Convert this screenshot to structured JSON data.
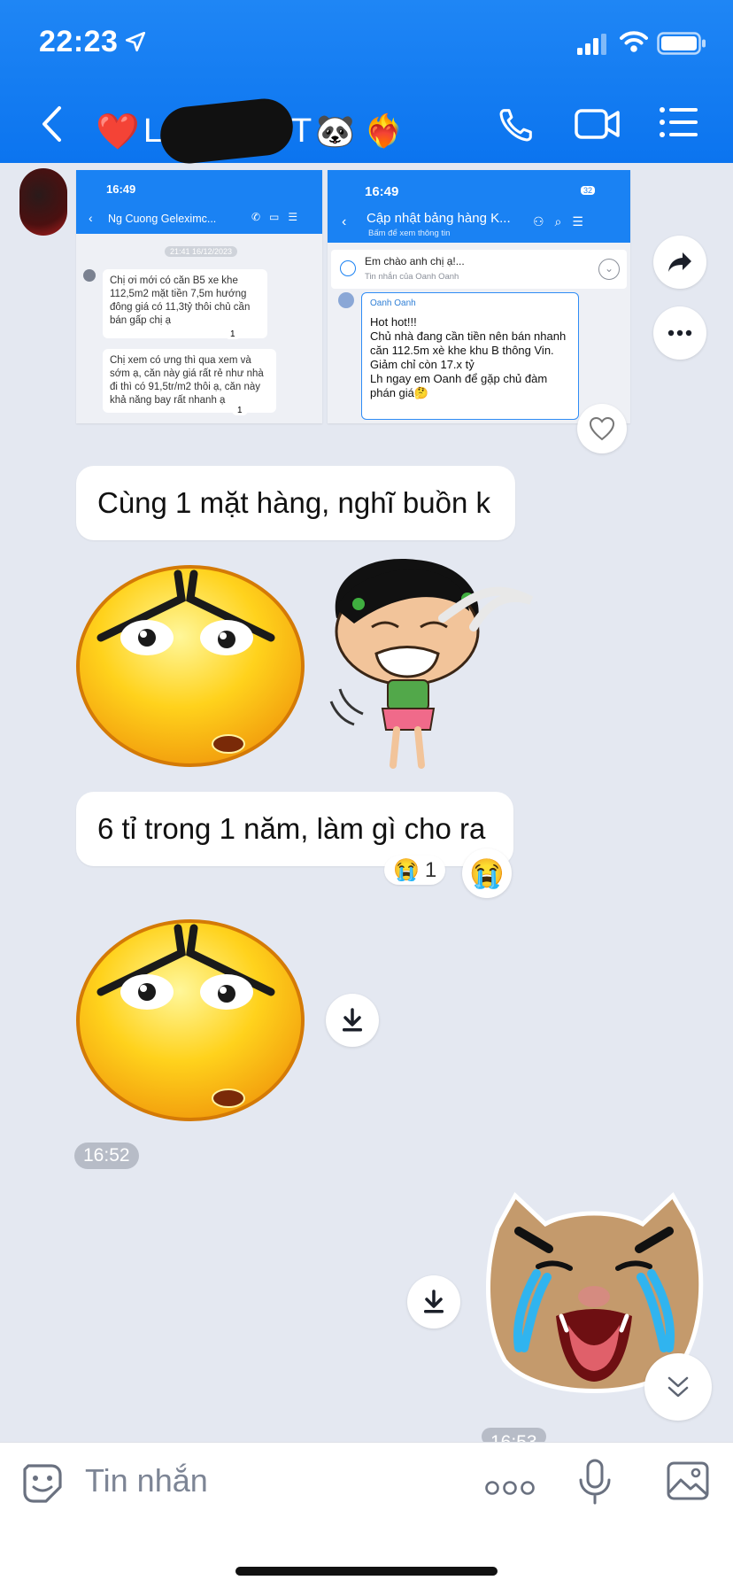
{
  "status_bar": {
    "time": "22:23"
  },
  "header": {
    "title_prefix": "L",
    "title_suffix": "T",
    "title_emojis_end": "🐼 ❤️‍🔥",
    "accent_color": "#0b74ef",
    "icons": [
      "back-icon",
      "phone-icon",
      "video-call-icon",
      "menu-list-icon"
    ]
  },
  "forwarded_screenshots": {
    "left": {
      "time": "16:49",
      "chat_name": "Ng Cuong Geleximc...",
      "date_chip": "21:41 16/12/2023",
      "messages": [
        "Chị ơi mới có căn B5 xe khe 112,5m2 mặt tiền 7,5m hướng đông giá có 11,3tỷ thôi chủ cần bán gấp chị ạ",
        "Chị xem có ưng thì qua xem và sớm ạ, căn này giá rất rẻ như nhà đi thì có 91,5tr/m2 thôi ạ, căn này khả năng bay rất nhanh ạ"
      ],
      "reaction_count": "1"
    },
    "right": {
      "time": "16:49",
      "battery": "32",
      "chat_name": "Cập nhật bảng hàng K...",
      "chat_subtitle": "Bấm để xem thông tin",
      "pinned_text": "Em chào anh chị ạ!...",
      "pinned_sub": "Tin nhắn của Oanh Oanh",
      "sender": "Oanh Oanh",
      "message": "Hot hot!!!\nChủ nhà đang cần tiền nên bán nhanh căn 112.5m xè khe khu B thông Vin. Giảm chỉ còn 17.x tỷ\nLh ngay em Oanh để gặp chủ đàm phán giá🤔"
    }
  },
  "messages": {
    "msg1": "Cùng 1 mặt hàng, nghĩ buồn k",
    "msg2": "6 tỉ trong 1 năm, làm gì cho ra",
    "msg2_reaction": "😭",
    "msg2_reaction_count": "1",
    "time1": "16:52",
    "time2": "16:53"
  },
  "input": {
    "placeholder": "Tin nhắn",
    "icons": [
      "sticker-icon",
      "more-icon",
      "mic-icon",
      "image-icon"
    ]
  }
}
